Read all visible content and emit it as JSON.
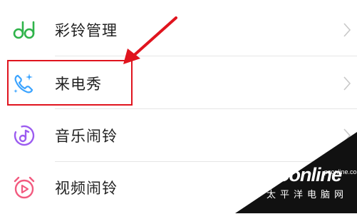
{
  "settings_list": {
    "items": [
      {
        "label": "彩铃管理",
        "icon": "ringback-tone-icon"
      },
      {
        "label": "来电秀",
        "icon": "phone-sparkle-icon"
      },
      {
        "label": "音乐闹铃",
        "icon": "music-note-icon"
      },
      {
        "label": "视频闹铃",
        "icon": "video-alarm-icon"
      }
    ]
  },
  "colors": {
    "icon_green": "#2fb34a",
    "icon_blue": "#3aa3ff",
    "icon_purple": "#9c5cf0",
    "icon_pink": "#f25a7f",
    "annotation_red": "#e0141e"
  },
  "watermark": {
    "logo": "PConline",
    "subtitle": "太平洋电脑网",
    "url": "pconline.com.cn"
  }
}
